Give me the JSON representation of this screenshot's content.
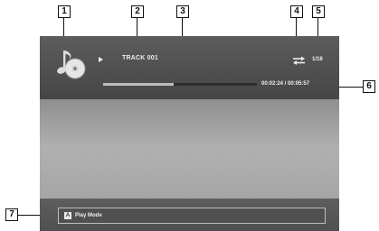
{
  "player": {
    "track_label": "TRACK 001",
    "track_count": "1/18",
    "time_display": "00:02:24 / 00:05:57",
    "progress": 0.46,
    "play_mode_key": "A",
    "play_mode_label": "Play Mode"
  },
  "icons": {
    "music": "music-cd-icon",
    "play": "play-icon",
    "repeat": "repeat-icon"
  },
  "callouts": [
    "1",
    "2",
    "3",
    "4",
    "5",
    "6",
    "7"
  ]
}
